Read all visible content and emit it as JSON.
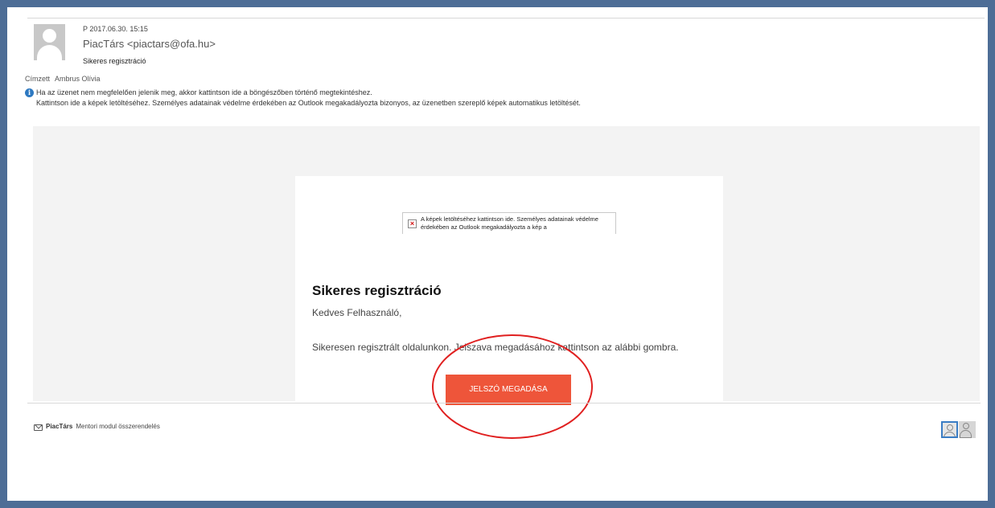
{
  "message": {
    "date": "P 2017.06.30. 15:15",
    "sender": "PiacTárs <piactars@ofa.hu>",
    "subject": "Sikeres regisztráció",
    "to_label": "Címzett",
    "to_name": "Ambrus Olívia",
    "info_line1": "Ha az üzenet nem megfelelően jelenik meg, akkor kattintson ide a böngészőben történő megtekintéshez.",
    "info_line2": "Kattintson ide a képek letöltéséhez. Személyes adatainak védelme érdekében az Outlook megakadályozta bizonyos, az üzenetben szereplő képek automatikus letöltését."
  },
  "email": {
    "image_alt": "A képek letöltéséhez kattintson ide. Személyes adatainak védelme érdekében az Outlook megakadályozta a kép a",
    "title": "Sikeres regisztráció",
    "greeting": "Kedves Felhasználó,",
    "body": "Sikeresen regisztrált oldalunkon. Jelszava megadásához kattintson az alábbi gombra.",
    "button": "JELSZÓ MEGADÁSA"
  },
  "footer": {
    "sender_name": "PiacTárs",
    "subject": "Mentori modul összerendelés"
  },
  "colors": {
    "frame": "#4d6d96",
    "button": "#ee553a",
    "highlight": "#e02020",
    "info_icon": "#2e79c1"
  }
}
